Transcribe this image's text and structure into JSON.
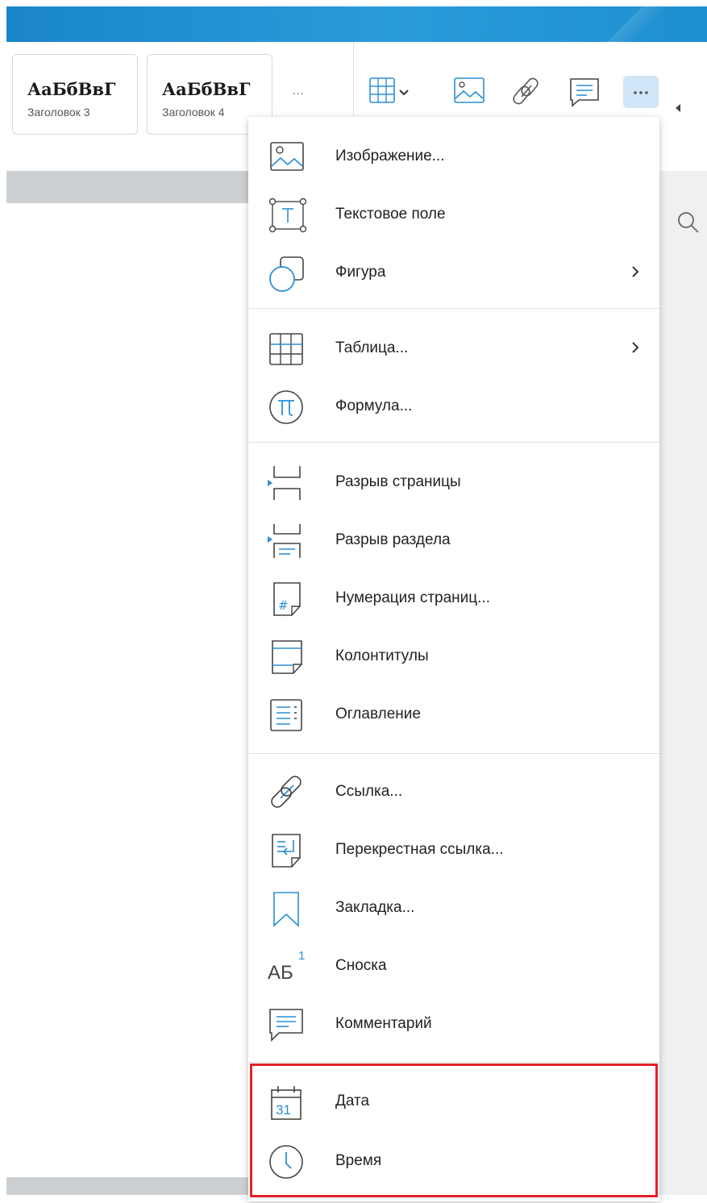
{
  "ribbon": {
    "styles": [
      {
        "sample": "АаБбВвГ",
        "name": "Заголовок 3"
      },
      {
        "sample": "АаБбВвГ",
        "name": "Заголовок 4"
      }
    ],
    "more_styles": "..."
  },
  "menu": {
    "items": [
      {
        "label": "Изображение...",
        "icon": "image-icon"
      },
      {
        "label": "Текстовое поле",
        "icon": "text-box-icon"
      },
      {
        "label": "Фигура",
        "icon": "shape-icon",
        "submenu": true
      },
      {
        "label": "Таблица...",
        "icon": "table-icon",
        "submenu": true
      },
      {
        "label": "Формула...",
        "icon": "formula-icon"
      },
      {
        "label": "Разрыв страницы",
        "icon": "page-break-icon"
      },
      {
        "label": "Разрыв раздела",
        "icon": "section-break-icon"
      },
      {
        "label": "Нумерация страниц...",
        "icon": "page-numbering-icon"
      },
      {
        "label": "Колонтитулы",
        "icon": "header-footer-icon"
      },
      {
        "label": "Оглавление",
        "icon": "toc-icon"
      },
      {
        "label": "Ссылка...",
        "icon": "link-icon"
      },
      {
        "label": "Перекрестная ссылка...",
        "icon": "cross-reference-icon"
      },
      {
        "label": "Закладка...",
        "icon": "bookmark-icon"
      },
      {
        "label": "Сноска",
        "icon": "footnote-icon",
        "icon_text": "АБ",
        "icon_sup": "1"
      },
      {
        "label": "Комментарий",
        "icon": "comment-icon"
      },
      {
        "label": "Дата",
        "icon": "calendar-icon",
        "icon_text": "31"
      },
      {
        "label": "Время",
        "icon": "clock-icon"
      }
    ]
  },
  "colors": {
    "accent": "#1a86c9",
    "icon_blue": "#2b8fd6",
    "highlight": "#e3202a"
  }
}
